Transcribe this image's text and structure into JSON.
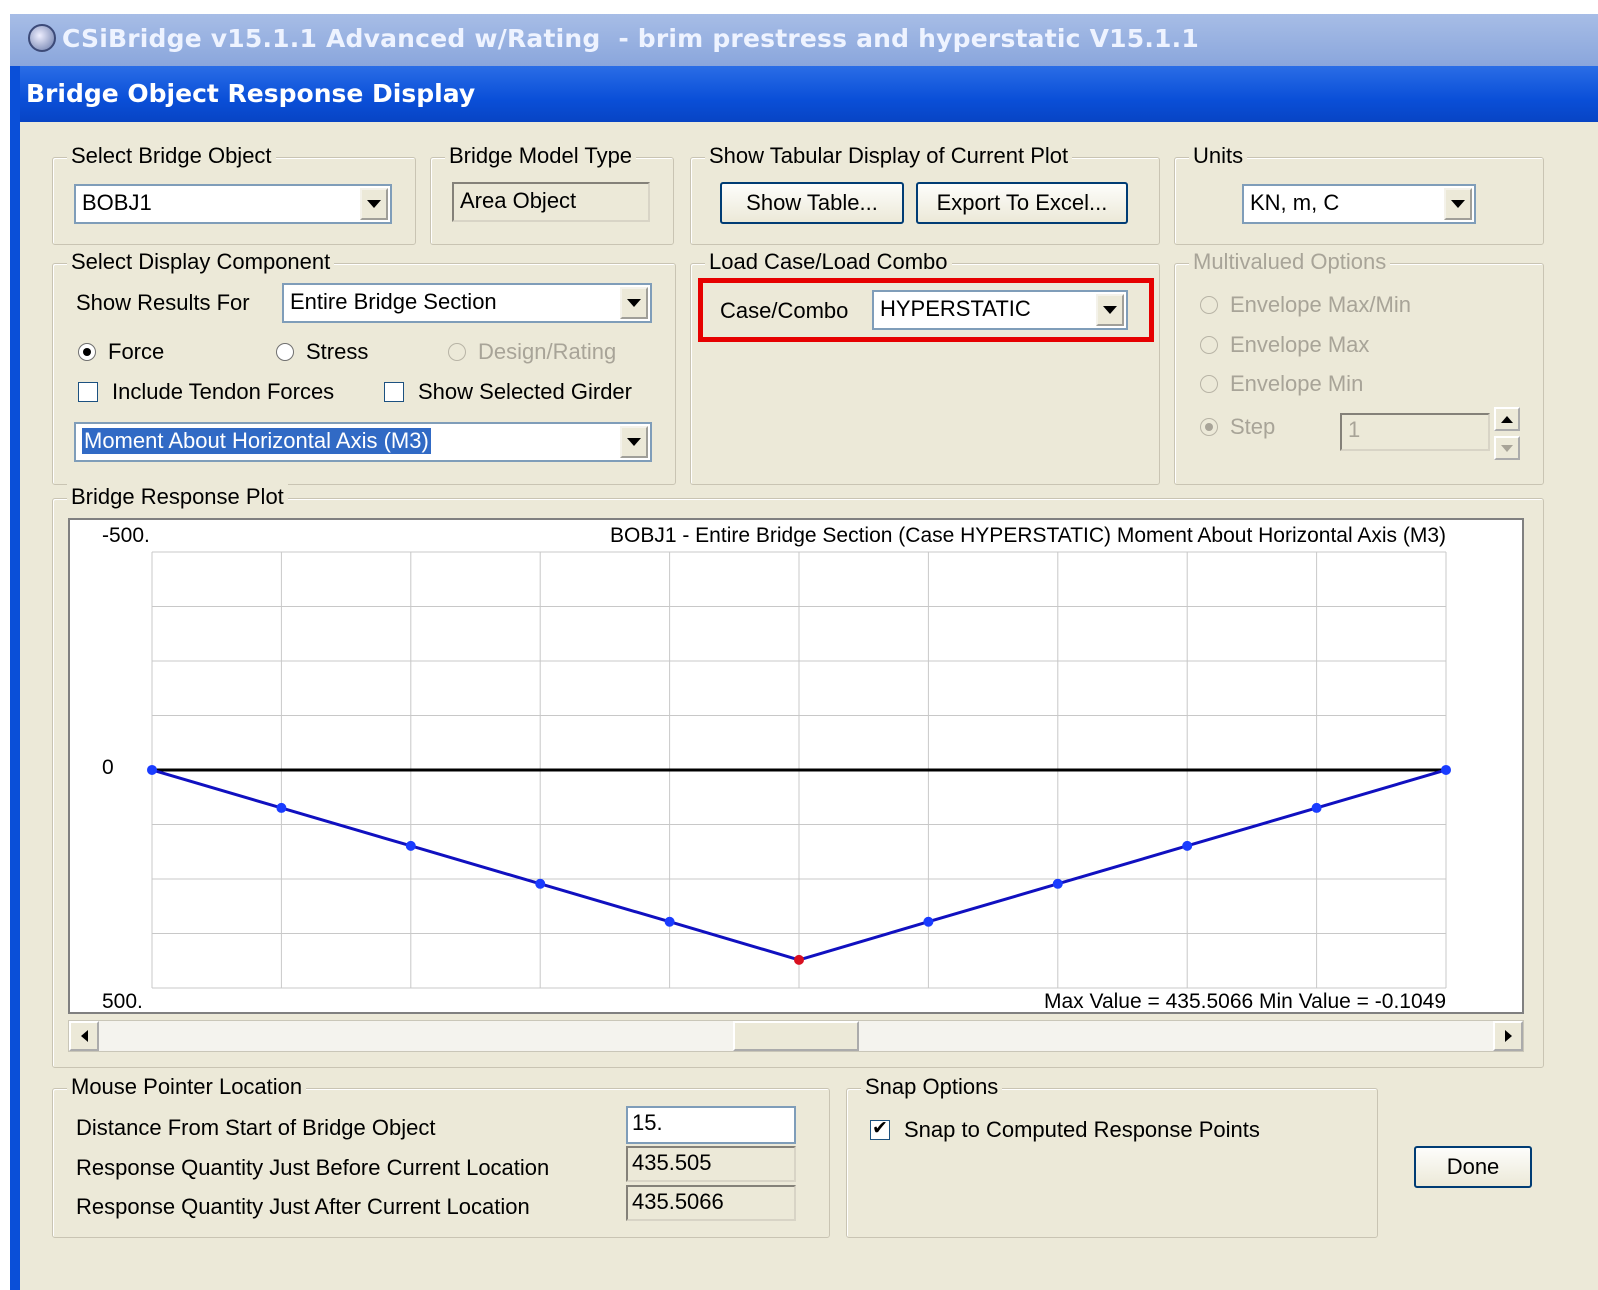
{
  "window": {
    "app_title": "CSiBridge v15.1.1 Advanced w/Rating  - brim prestress and hyperstatic V15.1.1",
    "dialog_title": "Bridge Object Response Display"
  },
  "select_bridge_object": {
    "label": "Select Bridge Object",
    "value": "BOBJ1"
  },
  "bridge_model_type": {
    "label": "Bridge Model Type",
    "value": "Area Object"
  },
  "tabular": {
    "label": "Show Tabular Display of Current Plot",
    "show_table": "Show Table...",
    "export_excel": "Export To Excel..."
  },
  "units": {
    "label": "Units",
    "value": "KN, m, C"
  },
  "display_component": {
    "label": "Select Display Component",
    "show_results_for_label": "Show Results For",
    "show_results_for_value": "Entire Bridge Section",
    "radio_force": "Force",
    "radio_stress": "Stress",
    "radio_design": "Design/Rating",
    "chk_tendon": "Include Tendon Forces",
    "chk_girder": "Show Selected Girder",
    "component_value": "Moment About Horizontal Axis  (M3)"
  },
  "load_case": {
    "label": "Load Case/Load Combo",
    "case_label": "Case/Combo",
    "case_value": "HYPERSTATIC"
  },
  "multivalued": {
    "label": "Multivalued Options",
    "env_maxmin": "Envelope Max/Min",
    "env_max": "Envelope Max",
    "env_min": "Envelope Min",
    "step": "Step",
    "step_value": "1"
  },
  "plot": {
    "label": "Bridge Response Plot",
    "header": "BOBJ1 - Entire Bridge Section   (Case HYPERSTATIC)   Moment About Horizontal Axis  (M3)",
    "y_top": "-500.",
    "y_zero": "0",
    "y_bottom": "500.",
    "stats": "Max Value = 435.5066    Min Value = -0.1049"
  },
  "chart_data": {
    "type": "line",
    "x": [
      0,
      1,
      2,
      3,
      4,
      5,
      6,
      7,
      8,
      9,
      10
    ],
    "series": [
      {
        "values": [
          -0.1049,
          87,
          174,
          261,
          348,
          435.5066,
          348,
          261,
          174,
          87,
          -0.1049
        ]
      }
    ],
    "ylim": [
      -500,
      500
    ],
    "y_inverted": true,
    "highlight_index": 5,
    "grid": true,
    "colors": {
      "line": "#1010c0",
      "points": "#1a3cff",
      "highlight": "#d81020",
      "zero_line": "#000000",
      "grid": "#c8c8c8"
    }
  },
  "mouse_pointer": {
    "label": "Mouse Pointer Location",
    "distance_label": "Distance From Start of Bridge Object",
    "distance_value": "15.",
    "before_label": "Response Quantity Just Before Current Location",
    "before_value": "435.505",
    "after_label": "Response Quantity Just After Current Location",
    "after_value": "435.5066"
  },
  "snap": {
    "label": "Snap Options",
    "chk_snap": "Snap to Computed Response Points"
  },
  "done": "Done"
}
